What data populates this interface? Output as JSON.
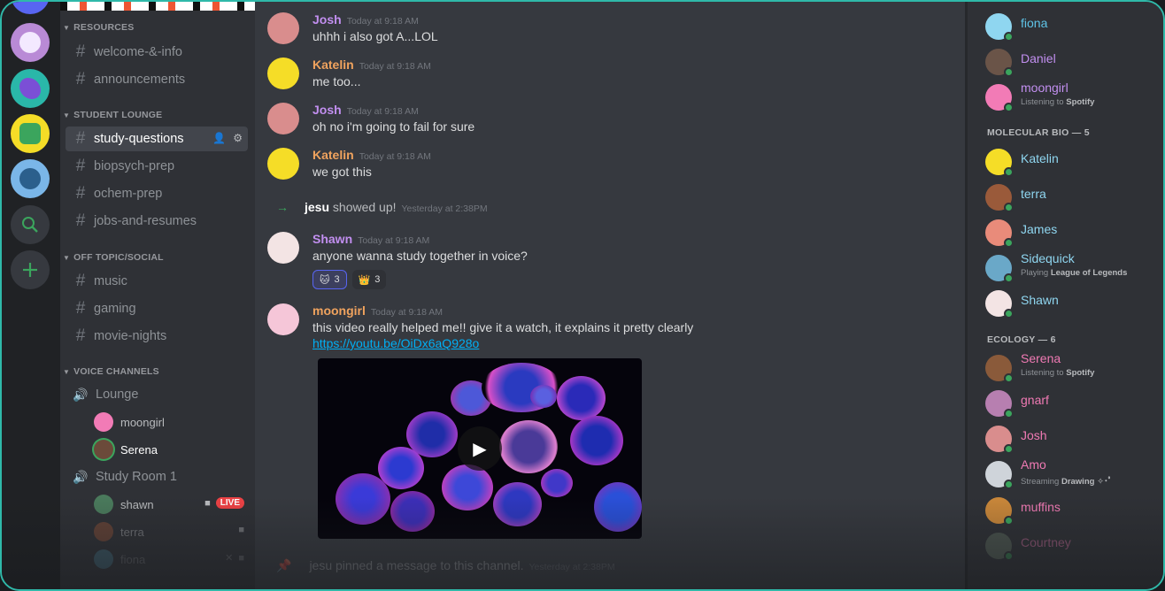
{
  "channels": {
    "categories": [
      "RESOURCES",
      "STUDENT LOUNGE",
      "OFF TOPIC/SOCIAL",
      "VOICE CHANNELS"
    ],
    "resources": [
      "welcome-&-info",
      "announcements"
    ],
    "student_lounge": [
      "study-questions",
      "biopsych-prep",
      "ochem-prep",
      "jobs-and-resumes"
    ],
    "off_topic": [
      "music",
      "gaming",
      "movie-nights"
    ],
    "voice": {
      "lounge": "Lounge",
      "lounge_users": [
        "moongirl",
        "Serena"
      ],
      "study_room": "Study Room 1",
      "study_users": [
        "shawn",
        "terra",
        "fiona"
      ],
      "live_label": "LIVE"
    }
  },
  "chat": {
    "messages": [
      {
        "user": "Josh",
        "time": "Today at 9:18 AM",
        "text": "uhhh i also got A...LOL",
        "color": "#c28ff0"
      },
      {
        "user": "Katelin",
        "time": "Today at 9:18 AM",
        "text": "me too...",
        "color": "#f0a35e"
      },
      {
        "user": "Josh",
        "time": "Today at 9:18 AM",
        "text": "oh no i'm going to fail for sure",
        "color": "#c28ff0"
      },
      {
        "user": "Katelin",
        "time": "Today at 9:18 AM",
        "text": "we got this",
        "color": "#f0a35e"
      },
      {
        "user": "Shawn",
        "time": "Today at 9:18 AM",
        "text": "anyone wanna study together in voice?",
        "color": "#c28ff0"
      },
      {
        "user": "moongirl",
        "time": "Today at 9:18 AM",
        "text": "this video really helped me!! give it a watch, it explains it pretty clearly",
        "color": "#f0a35e"
      }
    ],
    "join": {
      "user": "jesu",
      "text": "showed up!",
      "time": "Yesterday at 2:38PM"
    },
    "reactions": [
      {
        "emoji": "🐱",
        "count": "3"
      },
      {
        "emoji": "👑",
        "count": "3"
      }
    ],
    "link": "https://youtu.be/OiDx6aQ928o",
    "pinned": {
      "user": "jesu",
      "text": "pinned a message to this channel.",
      "time": "Yesterday at 2:38PM"
    }
  },
  "members": {
    "top": [
      {
        "name": "fiona",
        "color": "#5fc4e8"
      },
      {
        "name": "Daniel",
        "color": "#c28ff0"
      },
      {
        "name": "moongirl",
        "color": "#c28ff0",
        "activity_prefix": "Listening to",
        "activity": "Spotify"
      }
    ],
    "group1": "MOLECULAR BIO — 5",
    "group1_members": [
      {
        "name": "Katelin",
        "color": "#8fd6f0"
      },
      {
        "name": "terra",
        "color": "#8fd6f0"
      },
      {
        "name": "James",
        "color": "#8fd6f0"
      },
      {
        "name": "Sidequick",
        "color": "#8fd6f0",
        "activity_prefix": "Playing",
        "activity": "League of Legends"
      },
      {
        "name": "Shawn",
        "color": "#8fd6f0"
      }
    ],
    "group2": "ECOLOGY — 6",
    "group2_members": [
      {
        "name": "Serena",
        "color": "#f07ab4",
        "activity_prefix": "Listening to",
        "activity": "Spotify"
      },
      {
        "name": "gnarf",
        "color": "#f07ab4"
      },
      {
        "name": "Josh",
        "color": "#f07ab4"
      },
      {
        "name": "Amo",
        "color": "#f07ab4",
        "activity_prefix": "Streaming",
        "activity": "Drawing ✧･ﾟ"
      },
      {
        "name": "muffins",
        "color": "#f07ab4"
      },
      {
        "name": "Courtney",
        "color": "#f07ab4"
      }
    ]
  }
}
